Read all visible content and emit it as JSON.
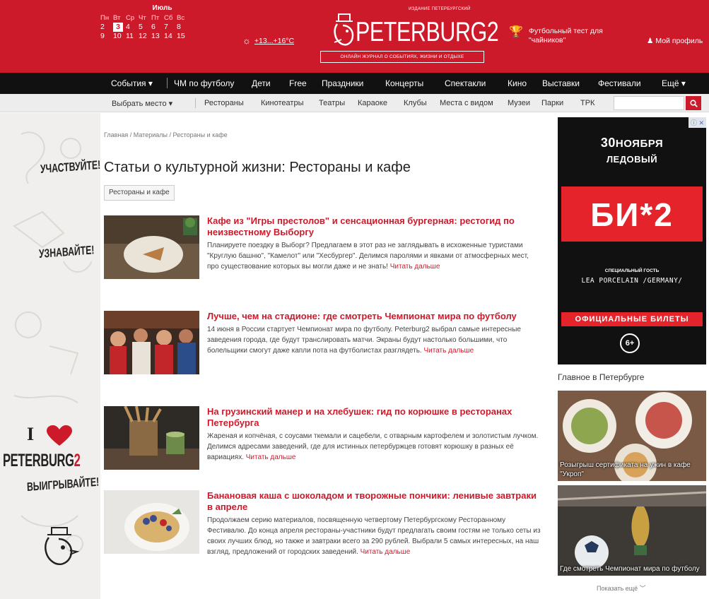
{
  "header": {
    "calendar": {
      "month": "Июль",
      "weekdays": [
        "Пн",
        "Вт",
        "Ср",
        "Чт",
        "Пт",
        "Сб",
        "Вс"
      ],
      "week1": [
        "2",
        "3",
        "4",
        "5",
        "6",
        "7",
        "8"
      ],
      "week2": [
        "9",
        "10",
        "11",
        "12",
        "13",
        "14",
        "15"
      ],
      "today": "3"
    },
    "weather": "+13...+16°C",
    "logo": {
      "top_text": "ИЗДАНИЕ ПЕТЕРБУРГСКИЙ",
      "word": "PETERBURG2",
      "tagline": "ОНЛАЙН ЖУРНАЛ О СОБЫТИЯХ, ЖИЗНИ И ОТДЫХЕ"
    },
    "promo": "Футбольный тест для \"чайников\"",
    "profile": "Мой профиль"
  },
  "nav": {
    "items": [
      "События ▾",
      "ЧМ по футболу",
      "Дети",
      "Free",
      "Праздники",
      "Концерты",
      "Спектакли",
      "Кино",
      "Выставки",
      "Фестивали",
      "Ещё ▾"
    ]
  },
  "subnav": {
    "place": "Выбрать место ▾",
    "items": [
      "Рестораны",
      "Кинотеатры",
      "Театры",
      "Караоке",
      "Клубы",
      "Места с видом",
      "Музеи",
      "Парки",
      "ТРК"
    ],
    "search_placeholder": ""
  },
  "left_band": {
    "slogan1": "УЧАСТВУЙТЕ!",
    "slogan2": "УЗНАВАЙТЕ!",
    "slogan3": "ВЫИГРЫВАЙТЕ!",
    "i_letter": "I",
    "brand_main": "PETERBURG",
    "brand_digit": "2"
  },
  "main": {
    "breadcrumb": [
      "Главная",
      "Материалы",
      "Рестораны и кафе"
    ],
    "title": "Статьи о культурной жизни: Рестораны и кафе",
    "filter": "Рестораны и кафе",
    "articles": [
      {
        "title": "Кафе из \"Игры престолов\" и сенсационная бургерная: рестогид по неизвестному Выборгу",
        "desc": "Планируете поездку в Выборг? Предлагаем в этот раз не заглядывать в исхоженные туристами \"Круглую башню\", \"Камелот\" или \"Хесбургер\". Делимся паролями и явками от атмосферных мест, про существование которых вы могли даже и не знать! ",
        "more": "Читать дальше"
      },
      {
        "title": "Лучше, чем на стадионе: где смотреть Чемпионат мира по футболу",
        "desc": "14 июня в России стартует Чемпионат мира по футболу. Peterburg2 выбрал самые интересные заведения города, где будут транслировать матчи. Экраны будут настолько большими, что болельщики смогут даже капли пота на футболистах разглядеть. ",
        "more": "Читать дальше"
      },
      {
        "title": "На грузинский манер и на хлебушек: гид по корюшке в ресторанах Петербурга",
        "desc": "Жареная и копчёная, с соусами ткемали и сацебели, с отварным картофелем и золотистым лучком. Делимся адресами заведений, где для истинных петербуржцев готовят корюшку в разных её вариациях. ",
        "more": "Читать дальше"
      },
      {
        "title": "Банановая каша с шоколадом и творожные пончики: ленивые завтраки в апреле",
        "desc": "Продолжаем серию материалов, посвященную четвертому Петербургскому Ресторанному Фестивалю. До конца апреля рестораны-участники будут предлагать своим гостям не только сеты из своих лучших блюд, но также и завтраки всего за 290 рублей. Выбрали 5 самых интересных, на наш взгляд, предложений от городских заведений. ",
        "more": "Читать дальше"
      }
    ]
  },
  "sidebar": {
    "ad": {
      "date_num": "30",
      "date_month": "НОЯБРЯ",
      "venue": "ЛЕДОВЫЙ",
      "band": "БИ*2",
      "guest_label": "СПЕЦИАЛЬНЫЙ ГОСТЬ",
      "guest": "LEA PORCELAIN /GERMANY/",
      "tickets": "ОФИЦИАЛЬНЫЕ БИЛЕТЫ",
      "age": "6+"
    },
    "heading": "Главное в Петербурге",
    "cards": [
      {
        "caption": "Розыгрыш сертификата на ужин в кафе \"Укроп\""
      },
      {
        "caption": "Где смотреть Чемпионат мира по футболу"
      }
    ],
    "show_more": "Показать ещё ﹀"
  },
  "colors": {
    "brand_red": "#cd1a2b",
    "nav_black": "#111111",
    "subnav_grey": "#ededed"
  }
}
